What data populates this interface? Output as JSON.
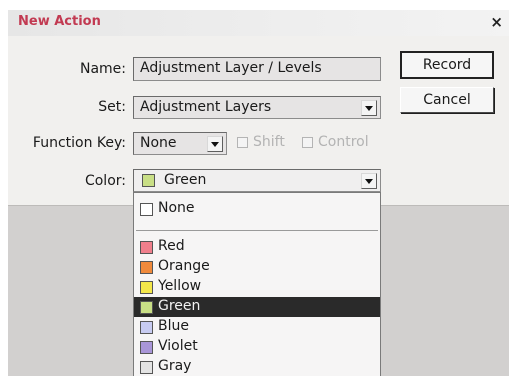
{
  "window": {
    "title": "New Action",
    "close_glyph": "×"
  },
  "form": {
    "name_label": "Name:",
    "name_value": "Adjustment Layer / Levels",
    "set_label": "Set:",
    "set_value": "Adjustment Layers",
    "function_key_label": "Function Key:",
    "function_key_value": "None",
    "shift_label": "Shift",
    "control_label": "Control",
    "color_label": "Color:",
    "color_value": "Green"
  },
  "buttons": {
    "record": "Record",
    "cancel": "Cancel"
  },
  "color_list": [
    {
      "label": "None",
      "color": "#ffffff"
    },
    {
      "label": "Red",
      "color": "#f07f8c"
    },
    {
      "label": "Orange",
      "color": "#f08a3c"
    },
    {
      "label": "Yellow",
      "color": "#f4e74a"
    },
    {
      "label": "Green",
      "color": "#c9df86",
      "selected": true
    },
    {
      "label": "Blue",
      "color": "#c7cbf1"
    },
    {
      "label": "Violet",
      "color": "#a996d8"
    },
    {
      "label": "Gray",
      "color": "#e3e3e3"
    }
  ],
  "colors": {
    "title_accent": "#c23a52",
    "selection": "#2a2a2a"
  }
}
